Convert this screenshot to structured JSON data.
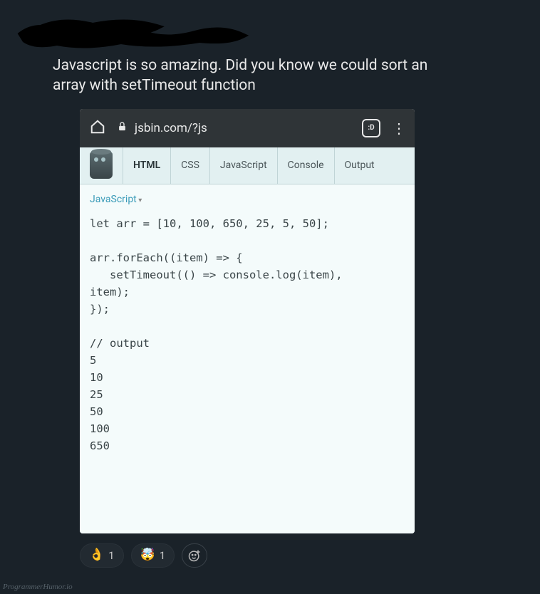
{
  "post": {
    "text": "Javascript is so amazing. Did you know we could sort an array with setTimeout function"
  },
  "browser": {
    "url": "jsbin.com/?js",
    "tab_count": ":D"
  },
  "jsbin": {
    "tabs": [
      "HTML",
      "CSS",
      "JavaScript",
      "Console",
      "Output"
    ],
    "active_tab": "HTML",
    "language_label": "JavaScript",
    "code_lines": [
      "let arr = [10, 100, 650, 25, 5, 50];",
      "",
      "arr.forEach((item) => {",
      "   setTimeout(() => console.log(item),",
      "item);",
      "});",
      "",
      "// output",
      "5",
      "10",
      "25",
      "50",
      "100",
      "650"
    ]
  },
  "reactions": [
    {
      "emoji": "👌",
      "count": "1"
    },
    {
      "emoji": "🤯",
      "count": "1"
    }
  ],
  "watermark": "ProgrammerHumor.io"
}
